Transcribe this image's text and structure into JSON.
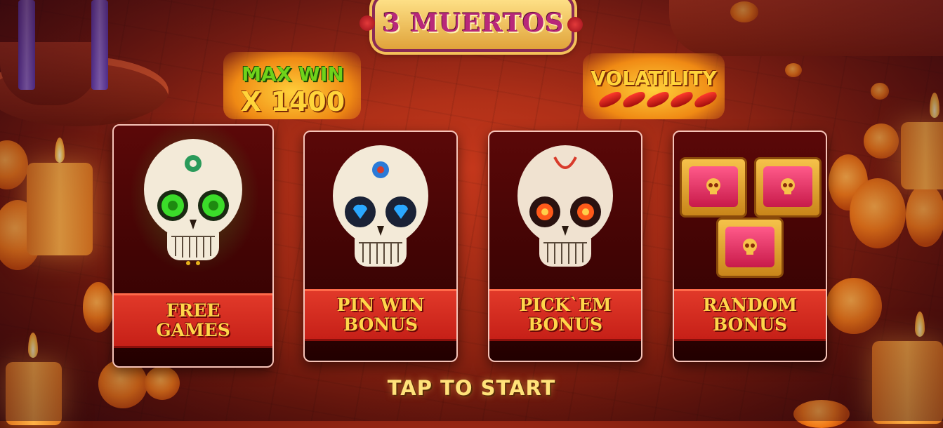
{
  "game": {
    "logo": "3 MUERTOS",
    "max_win": {
      "line1": "MAX WIN",
      "line2": "X 1400"
    },
    "volatility": {
      "label": "VOLATILITY",
      "chili_level": 5
    }
  },
  "features": [
    {
      "label": "FREE\nGAMES",
      "eye_color": "#3bdc2a"
    },
    {
      "label": "PIN WIN\nBONUS",
      "eye_color": "#2aa8ff"
    },
    {
      "label": "PICK`EM\nBONUS",
      "eye_color": "#ff5a1a"
    },
    {
      "label": "RANDOM\nBONUS"
    }
  ],
  "cta": {
    "tap_to_start": "TAP TO START"
  },
  "colors": {
    "accent_gold": "#ffd64a",
    "banner_red": "#e23a2a",
    "background": "#962613"
  }
}
